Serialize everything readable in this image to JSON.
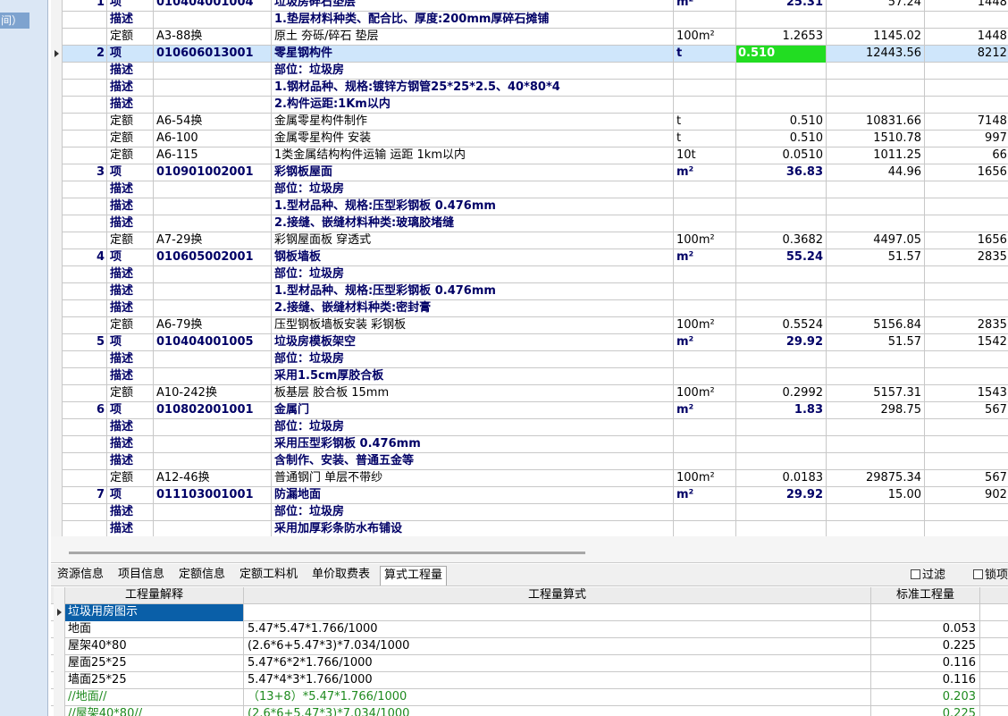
{
  "left_panel": {
    "tab_label": "间）"
  },
  "rows": [
    {
      "no": "1",
      "type": "项",
      "code": "010404001004",
      "name": "垃圾房碎石垫层",
      "unit": "m²",
      "qty": "25.31",
      "price": "57.24",
      "total": "1448.",
      "style": "item"
    },
    {
      "no": "",
      "type": "描述",
      "code": "",
      "name": "1.垫层材料种类、配合比、厚度:200mm厚碎石摊铺",
      "unit": "",
      "qty": "",
      "price": "",
      "total": "",
      "style": "desc"
    },
    {
      "no": "",
      "type": "定额",
      "code": "A3-88换",
      "name": "原土 夯砾/碎石 垫层",
      "unit": "100m²",
      "qty": "1.2653",
      "price": "1145.02",
      "total": "1448.",
      "style": "quota"
    },
    {
      "no": "2",
      "type": "项",
      "code": "010606013001",
      "name": "零星钢构件",
      "unit": "t",
      "qty": "0.510",
      "price": "12443.56",
      "total": "8212.",
      "style": "item",
      "selected": true
    },
    {
      "no": "",
      "type": "描述",
      "code": "",
      "name": "部位：垃圾房",
      "unit": "",
      "qty": "",
      "price": "",
      "total": "",
      "style": "desc"
    },
    {
      "no": "",
      "type": "描述",
      "code": "",
      "name": "1.钢材品种、规格:镀锌方钢管25*25*2.5、40*80*4",
      "unit": "",
      "qty": "",
      "price": "",
      "total": "",
      "style": "desc"
    },
    {
      "no": "",
      "type": "描述",
      "code": "",
      "name": "2.构件运距:1Km以内",
      "unit": "",
      "qty": "",
      "price": "",
      "total": "",
      "style": "desc"
    },
    {
      "no": "",
      "type": "定额",
      "code": "A6-54换",
      "name": "金属零星构件制作",
      "unit": "t",
      "qty": "0.510",
      "price": "10831.66",
      "total": "7148.",
      "style": "quota"
    },
    {
      "no": "",
      "type": "定额",
      "code": "A6-100",
      "name": "金属零星构件 安装",
      "unit": "t",
      "qty": "0.510",
      "price": "1510.78",
      "total": "997.",
      "style": "quota"
    },
    {
      "no": "",
      "type": "定额",
      "code": "A6-115",
      "name": "1类金属结构构件运输 运距 1km以内",
      "unit": "10t",
      "qty": "0.0510",
      "price": "1011.25",
      "total": "66.",
      "style": "quota"
    },
    {
      "no": "3",
      "type": "项",
      "code": "010901002001",
      "name": "彩钢板屋面",
      "unit": "m²",
      "qty": "36.83",
      "price": "44.96",
      "total": "1656.",
      "style": "item"
    },
    {
      "no": "",
      "type": "描述",
      "code": "",
      "name": "部位：垃圾房",
      "unit": "",
      "qty": "",
      "price": "",
      "total": "",
      "style": "desc"
    },
    {
      "no": "",
      "type": "描述",
      "code": "",
      "name": "1.型材品种、规格:压型彩钢板 0.476mm",
      "unit": "",
      "qty": "",
      "price": "",
      "total": "",
      "style": "desc"
    },
    {
      "no": "",
      "type": "描述",
      "code": "",
      "name": "2.接缝、嵌缝材料种类:玻璃胶堵缝",
      "unit": "",
      "qty": "",
      "price": "",
      "total": "",
      "style": "desc"
    },
    {
      "no": "",
      "type": "定额",
      "code": "A7-29换",
      "name": "彩钢屋面板 穿透式",
      "unit": "100m²",
      "qty": "0.3682",
      "price": "4497.05",
      "total": "1656.",
      "style": "quota"
    },
    {
      "no": "4",
      "type": "项",
      "code": "010605002001",
      "name": "钢板墙板",
      "unit": "m²",
      "qty": "55.24",
      "price": "51.57",
      "total": "2835.",
      "style": "item"
    },
    {
      "no": "",
      "type": "描述",
      "code": "",
      "name": "部位：垃圾房",
      "unit": "",
      "qty": "",
      "price": "",
      "total": "",
      "style": "desc"
    },
    {
      "no": "",
      "type": "描述",
      "code": "",
      "name": "1.型材品种、规格:压型彩钢板 0.476mm",
      "unit": "",
      "qty": "",
      "price": "",
      "total": "",
      "style": "desc"
    },
    {
      "no": "",
      "type": "描述",
      "code": "",
      "name": "2.接缝、嵌缝材料种类:密封膏",
      "unit": "",
      "qty": "",
      "price": "",
      "total": "",
      "style": "desc"
    },
    {
      "no": "",
      "type": "定额",
      "code": "A6-79换",
      "name": "压型钢板墙板安装 彩钢板",
      "unit": "100m²",
      "qty": "0.5524",
      "price": "5156.84",
      "total": "2835.",
      "style": "quota"
    },
    {
      "no": "5",
      "type": "项",
      "code": "010404001005",
      "name": "垃圾房模板架空",
      "unit": "m²",
      "qty": "29.92",
      "price": "51.57",
      "total": "1542.",
      "style": "item"
    },
    {
      "no": "",
      "type": "描述",
      "code": "",
      "name": "部位：垃圾房",
      "unit": "",
      "qty": "",
      "price": "",
      "total": "",
      "style": "desc"
    },
    {
      "no": "",
      "type": "描述",
      "code": "",
      "name": "采用1.5cm厚胶合板",
      "unit": "",
      "qty": "",
      "price": "",
      "total": "",
      "style": "desc"
    },
    {
      "no": "",
      "type": "定额",
      "code": "A10-242换",
      "name": "板基层 胶合板 15mm",
      "unit": "100m²",
      "qty": "0.2992",
      "price": "5157.31",
      "total": "1543.",
      "style": "quota"
    },
    {
      "no": "6",
      "type": "项",
      "code": "010802001001",
      "name": "金属门",
      "unit": "m²",
      "qty": "1.83",
      "price": "298.75",
      "total": "567.",
      "style": "item"
    },
    {
      "no": "",
      "type": "描述",
      "code": "",
      "name": "部位：垃圾房",
      "unit": "",
      "qty": "",
      "price": "",
      "total": "",
      "style": "desc"
    },
    {
      "no": "",
      "type": "描述",
      "code": "",
      "name": "采用压型彩钢板 0.476mm",
      "unit": "",
      "qty": "",
      "price": "",
      "total": "",
      "style": "desc"
    },
    {
      "no": "",
      "type": "描述",
      "code": "",
      "name": "含制作、安装、普通五金等",
      "unit": "",
      "qty": "",
      "price": "",
      "total": "",
      "style": "desc"
    },
    {
      "no": "",
      "type": "定额",
      "code": "A12-46换",
      "name": "普通钢门 单层不带纱",
      "unit": "100m²",
      "qty": "0.0183",
      "price": "29875.34",
      "total": "567.",
      "style": "quota"
    },
    {
      "no": "7",
      "type": "项",
      "code": "011103001001",
      "name": "防漏地面",
      "unit": "m²",
      "qty": "29.92",
      "price": "15.00",
      "total": "902.",
      "style": "item"
    },
    {
      "no": "",
      "type": "描述",
      "code": "",
      "name": "部位：垃圾房",
      "unit": "",
      "qty": "",
      "price": "",
      "total": "",
      "style": "desc"
    },
    {
      "no": "",
      "type": "描述",
      "code": "",
      "name": "采用加厚彩条防水布铺设",
      "unit": "",
      "qty": "",
      "price": "",
      "total": "",
      "style": "desc"
    }
  ],
  "tabs": [
    {
      "label": "资源信息",
      "active": false
    },
    {
      "label": "项目信息",
      "active": false
    },
    {
      "label": "定额信息",
      "active": false
    },
    {
      "label": "定额工料机",
      "active": false
    },
    {
      "label": "单价取费表",
      "active": false
    },
    {
      "label": "算式工程量",
      "active": true
    }
  ],
  "checkboxes": {
    "filter": "过滤",
    "lock": "锁项"
  },
  "bottom": {
    "headers": {
      "explanation": "工程量解释",
      "formula": "工程量算式",
      "standard": "标准工程量"
    },
    "rows": [
      {
        "expl": "垃圾用房图示",
        "formula": "",
        "std": "",
        "selected": true,
        "color": "normal"
      },
      {
        "expl": "地面",
        "formula": "5.47*5.47*1.766/1000",
        "std": "0.053",
        "color": "normal"
      },
      {
        "expl": "屋架40*80",
        "formula": "(2.6*6+5.47*3)*7.034/1000",
        "std": "0.225",
        "color": "normal"
      },
      {
        "expl": "屋面25*25",
        "formula": "5.47*6*2*1.766/1000",
        "std": "0.116",
        "color": "normal"
      },
      {
        "expl": "墙面25*25",
        "formula": "5.47*4*3*1.766/1000",
        "std": "0.116",
        "color": "normal"
      },
      {
        "expl": "//地面//",
        "formula": "（13+8）*5.47*1.766/1000",
        "std": "0.203",
        "color": "green"
      },
      {
        "expl": "//屋架40*80//",
        "formula": "(2.6*6+5.47*3)*7.034/1000",
        "std": "0.225",
        "color": "green"
      }
    ]
  },
  "colors": {
    "selection": "#cfe6fb",
    "active_cell": "#22dd22",
    "desc_text": "#000066",
    "comment_text": "#1e8a1e"
  }
}
